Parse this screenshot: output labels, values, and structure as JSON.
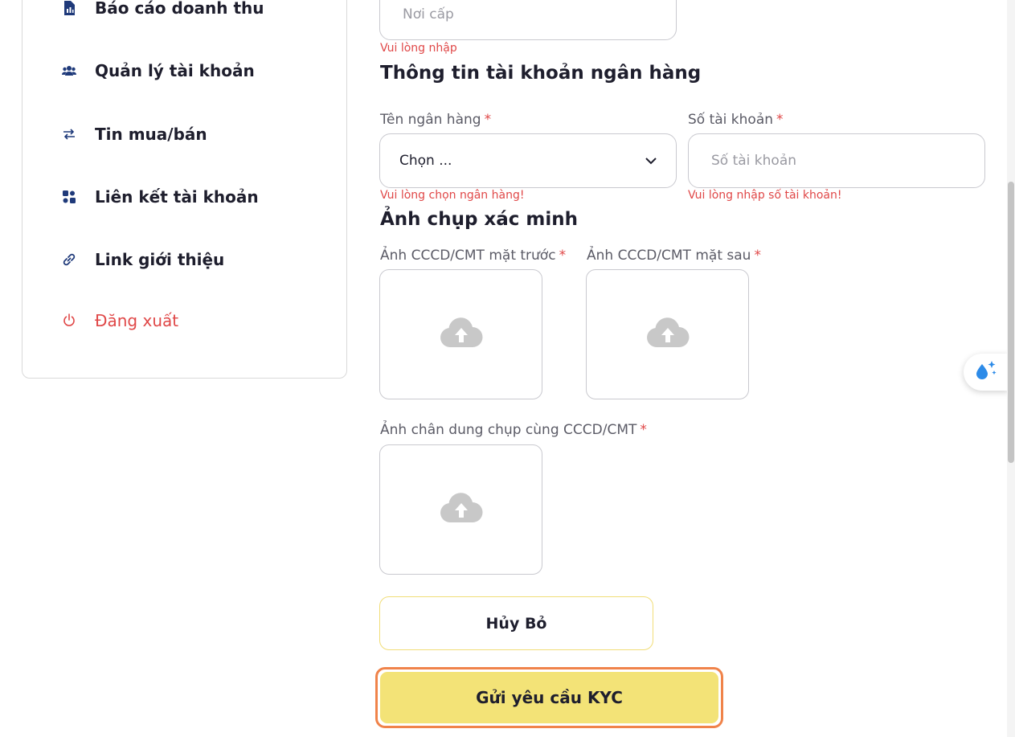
{
  "sidebar": {
    "items": [
      {
        "label": "Báo cáo doanh thu",
        "icon": "report-icon"
      },
      {
        "label": "Quản lý tài khoản",
        "icon": "users-icon"
      },
      {
        "label": "Tin mua/bán",
        "icon": "swap-icon"
      },
      {
        "label": "Liên kết tài khoản",
        "icon": "link-accounts-icon"
      },
      {
        "label": "Link giới thiệu",
        "icon": "link-icon"
      },
      {
        "label": "Đăng xuất",
        "icon": "power-icon"
      }
    ]
  },
  "form": {
    "issue_place": {
      "placeholder": "Nơi cấp",
      "error": "Vui lòng nhập"
    },
    "bank_section_title": "Thông tin tài khoản ngân hàng",
    "bank_name": {
      "label": "Tên ngân hàng",
      "required": "*",
      "selected": "Chọn ...",
      "error": "Vui lòng chọn ngân hàng!"
    },
    "account_number": {
      "label": "Số tài khoản",
      "required": "*",
      "placeholder": "Số tài khoản",
      "error": "Vui lòng nhập số tài khoản!"
    },
    "photo_section_title": "Ảnh chụp xác minh",
    "id_front": {
      "label": "Ảnh CCCD/CMT mặt trước",
      "required": "*"
    },
    "id_back": {
      "label": "Ảnh CCCD/CMT mặt sau",
      "required": "*"
    },
    "portrait": {
      "label": "Ảnh chân dung chụp cùng CCCD/CMT",
      "required": "*"
    },
    "cancel_label": "Hủy Bỏ",
    "submit_label": "Gửi yêu cầu KYC"
  },
  "colors": {
    "accent": "#f3e377",
    "error": "#e04848",
    "focus": "#f0834a"
  }
}
